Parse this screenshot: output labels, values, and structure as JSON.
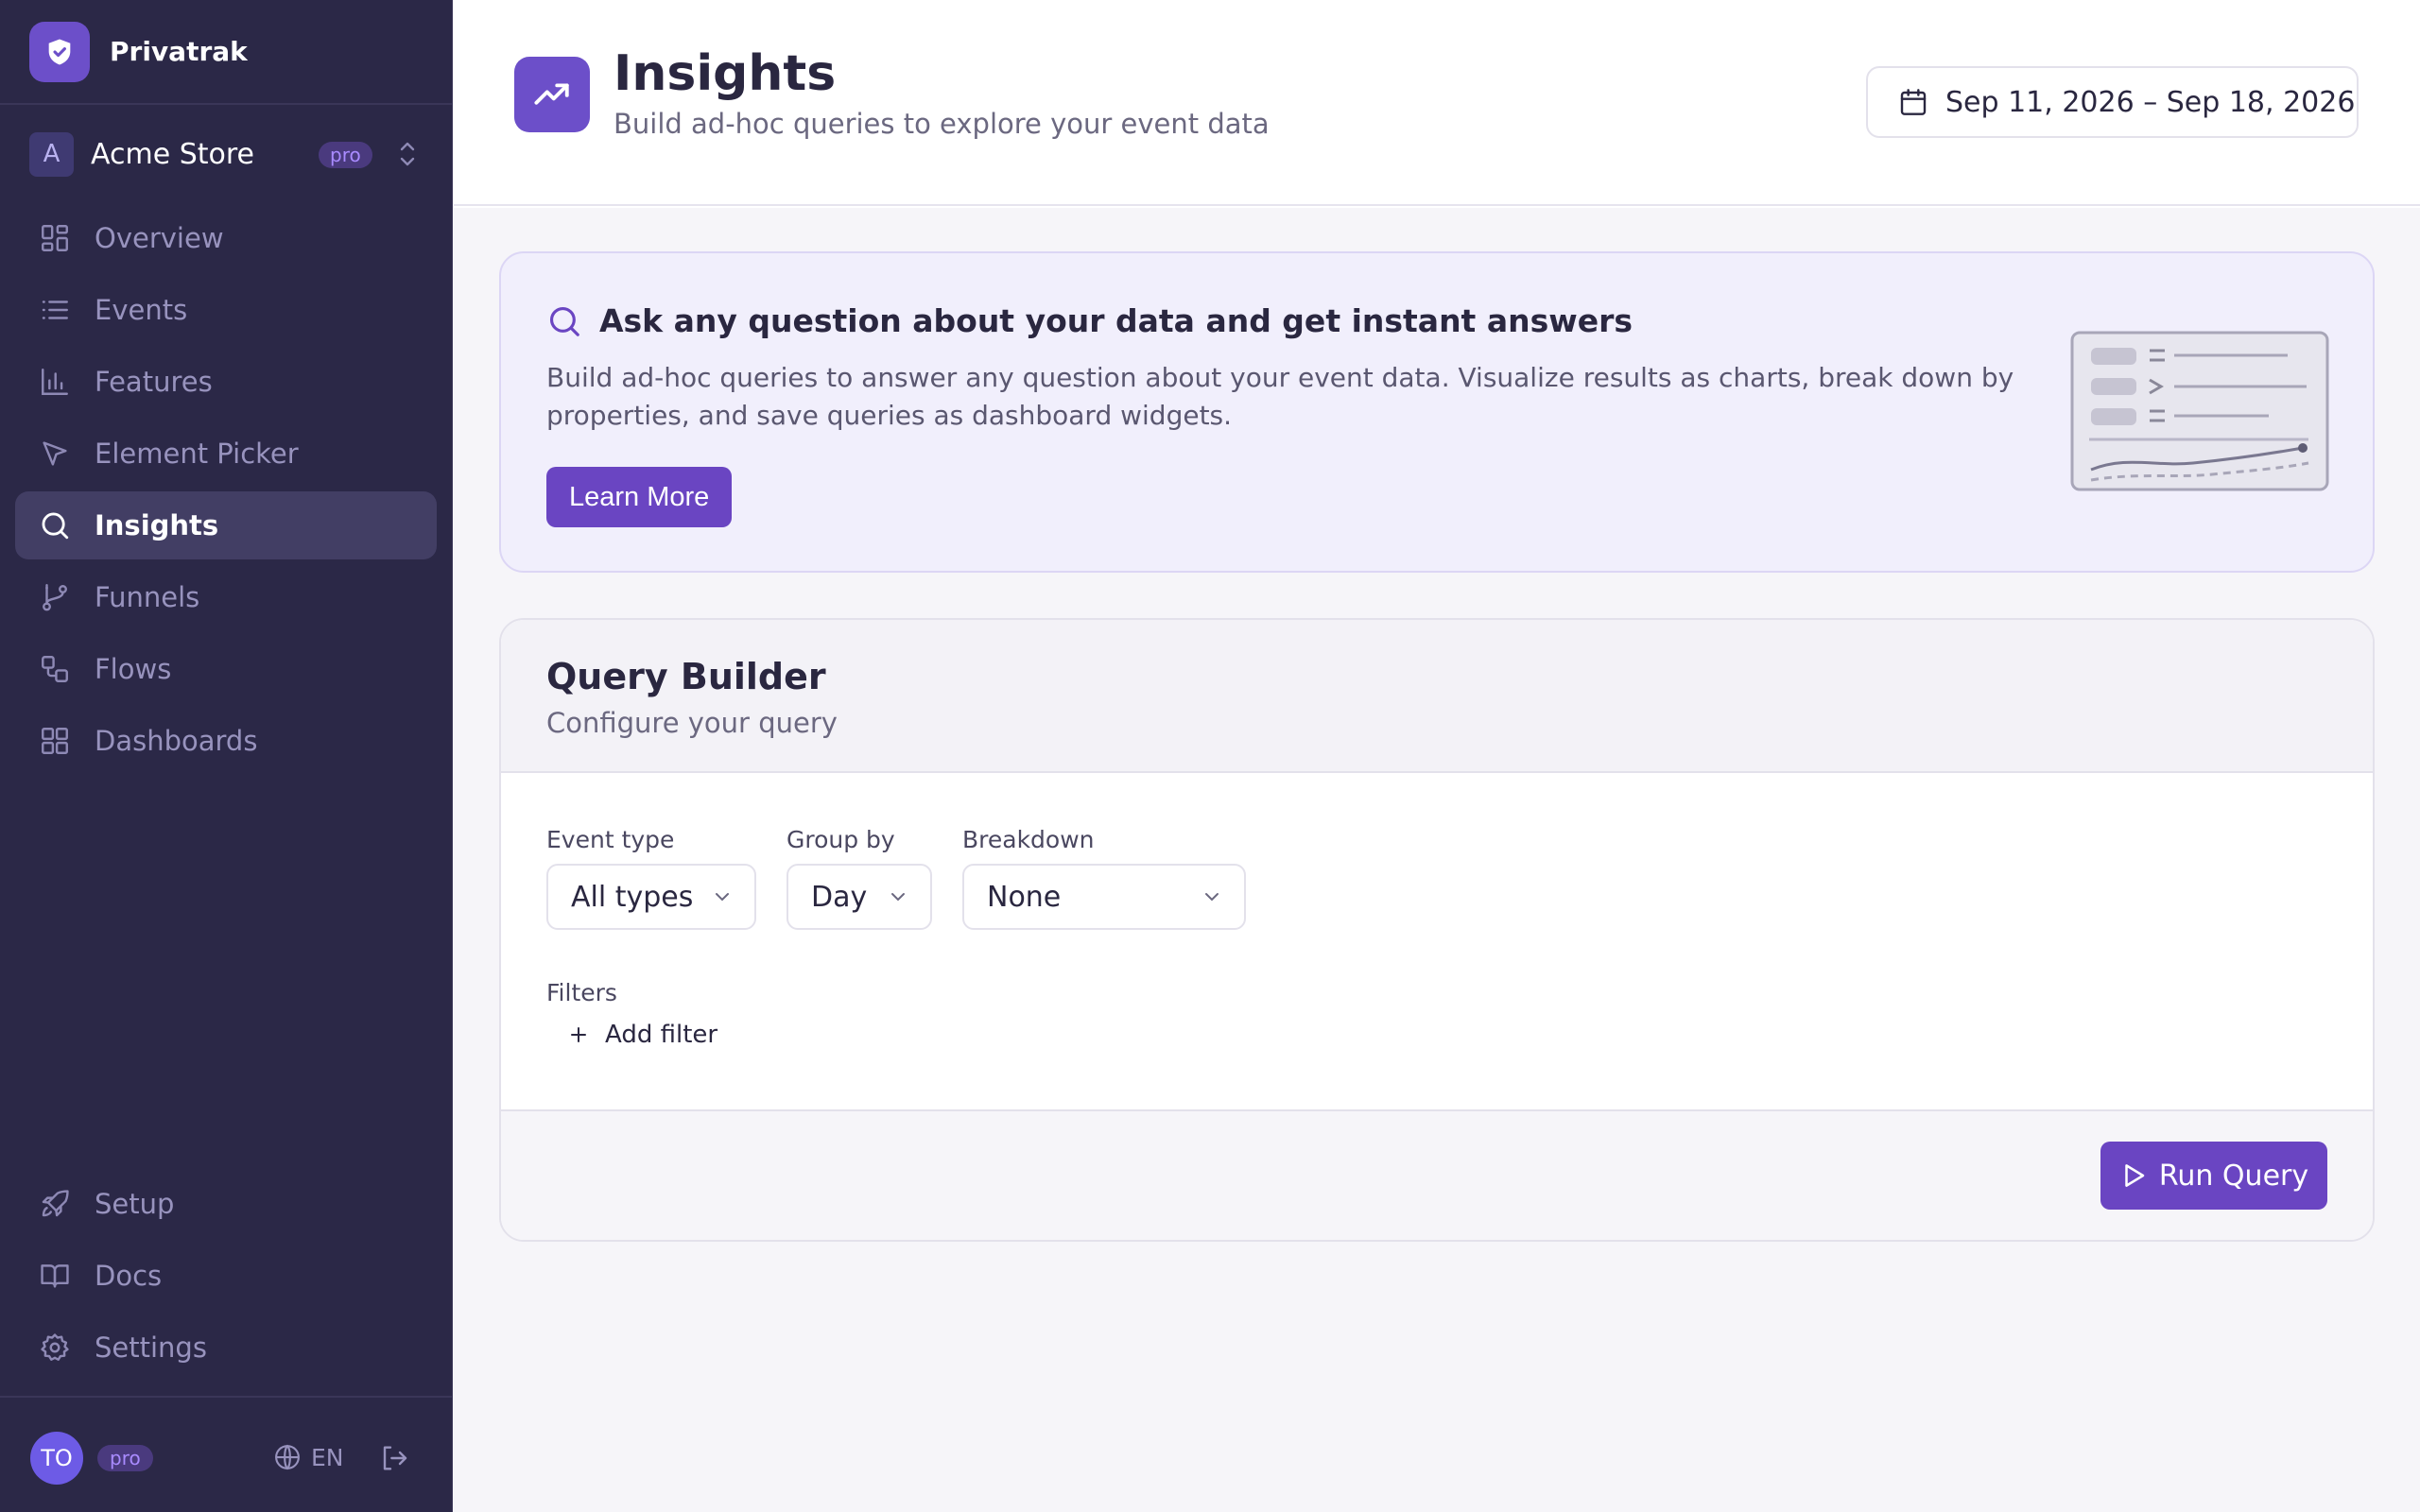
{
  "app": {
    "name": "Privatrak",
    "brand_color": "#6c4fc9"
  },
  "workspace": {
    "initial": "A",
    "name": "Acme Store",
    "plan_badge": "pro"
  },
  "sidebar": {
    "items": [
      {
        "label": "Overview",
        "icon": "grid-layout-icon"
      },
      {
        "label": "Events",
        "icon": "list-icon"
      },
      {
        "label": "Features",
        "icon": "bar-chart-icon"
      },
      {
        "label": "Element Picker",
        "icon": "cursor-pointer-icon"
      },
      {
        "label": "Insights",
        "icon": "search-icon",
        "active": true
      },
      {
        "label": "Funnels",
        "icon": "git-branch-icon"
      },
      {
        "label": "Flows",
        "icon": "workflow-icon"
      },
      {
        "label": "Dashboards",
        "icon": "dashboard-grid-icon"
      }
    ],
    "bottom_items": [
      {
        "label": "Setup",
        "icon": "rocket-icon"
      },
      {
        "label": "Docs",
        "icon": "book-icon"
      },
      {
        "label": "Settings",
        "icon": "gear-icon"
      }
    ]
  },
  "user": {
    "initials": "TO",
    "plan_badge": "pro",
    "language": "EN"
  },
  "header": {
    "title": "Insights",
    "subtitle": "Build ad-hoc queries to explore your event data",
    "date_range": "Sep 11, 2026 – Sep 18, 2026"
  },
  "hero": {
    "title": "Ask any question about your data and get instant answers",
    "description": "Build ad-hoc queries to answer any question about your event data. Visualize results as charts, break down by properties, and save queries as dashboard widgets.",
    "button_label": "Learn More"
  },
  "query_builder": {
    "title": "Query Builder",
    "subtitle": "Configure your query",
    "fields": {
      "event_type": {
        "label": "Event type",
        "value": "All types"
      },
      "group_by": {
        "label": "Group by",
        "value": "Day"
      },
      "breakdown": {
        "label": "Breakdown",
        "value": "None"
      }
    },
    "filters_label": "Filters",
    "add_filter_label": "Add filter",
    "run_label": "Run Query"
  },
  "colors": {
    "sidebar_bg": "#2b2847",
    "accent": "#6a45c2",
    "hero_bg": "#f1effc"
  }
}
